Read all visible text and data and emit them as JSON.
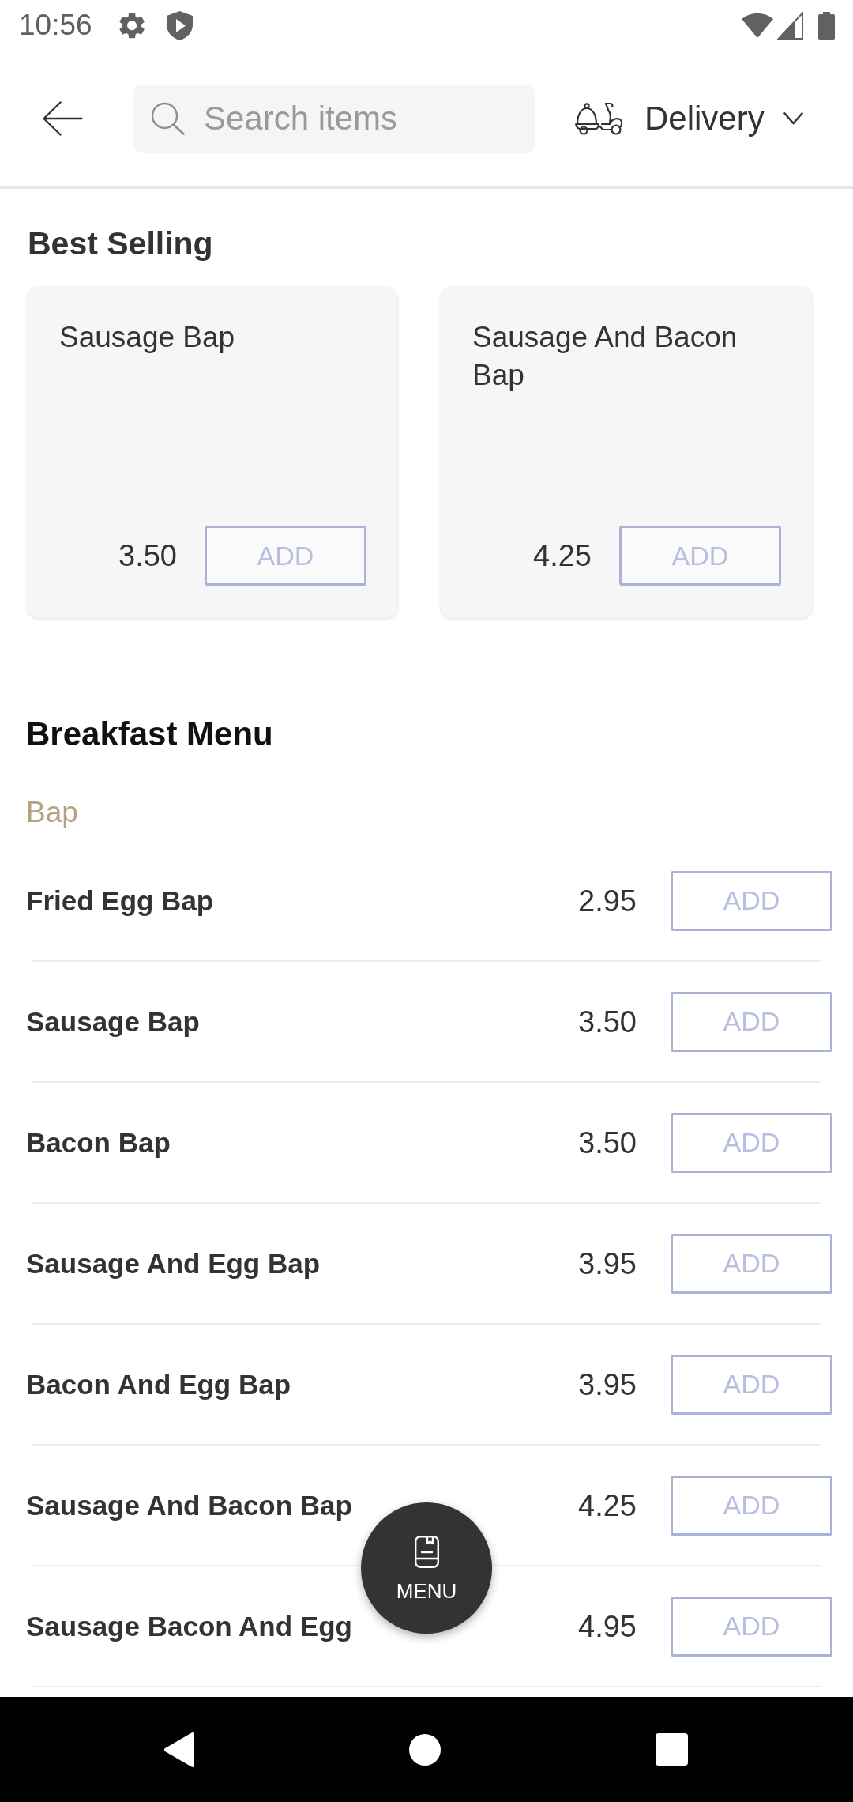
{
  "status_bar": {
    "time": "10:56"
  },
  "header": {
    "search": {
      "placeholder": "Search items"
    },
    "order_mode": {
      "label": "Delivery"
    }
  },
  "best_selling": {
    "title": "Best Selling",
    "items": [
      {
        "name": "Sausage Bap",
        "price": "3.50",
        "action": "ADD"
      },
      {
        "name": "Sausage And Bacon Bap",
        "price": "4.25",
        "action": "ADD"
      }
    ]
  },
  "menu": {
    "title": "Breakfast Menu",
    "categories": [
      {
        "name": "Bap",
        "items": [
          {
            "name": "Fried Egg Bap",
            "price": "2.95",
            "action": "ADD"
          },
          {
            "name": "Sausage Bap",
            "price": "3.50",
            "action": "ADD"
          },
          {
            "name": "Bacon Bap",
            "price": "3.50",
            "action": "ADD"
          },
          {
            "name": "Sausage And Egg Bap",
            "price": "3.95",
            "action": "ADD"
          },
          {
            "name": "Bacon And Egg Bap",
            "price": "3.95",
            "action": "ADD"
          },
          {
            "name": "Sausage And Bacon Bap",
            "price": "4.25",
            "action": "ADD"
          },
          {
            "name": "Sausage Bacon And Egg",
            "price": "4.95",
            "action": "ADD"
          }
        ]
      }
    ]
  },
  "fab": {
    "label": "MENU"
  }
}
